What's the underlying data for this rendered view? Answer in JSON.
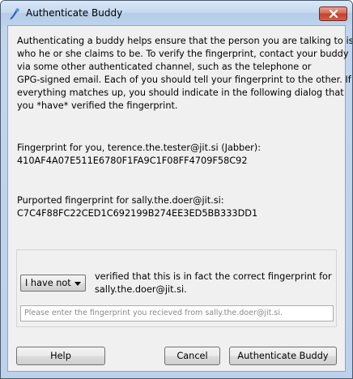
{
  "window": {
    "title": "Authenticate Buddy"
  },
  "intro": {
    "lines": [
      "Authenticating a buddy helps ensure that the person you are talking to is",
      "who he or she claims to be. To verify the fingerprint, contact your buddy",
      "via some other authenticated channel, such as the telephone or",
      "GPG-signed email. Each of you should tell your fingerprint to the other. If",
      "everything matches up, you should indicate in the following dialog that",
      "you *have* verified the fingerprint."
    ]
  },
  "own_fingerprint": {
    "label": "Fingerprint for you, terence.the.tester@jit.si (Jabber):",
    "value": "410AF4A07E511E6780F1FA9C1F08FF4709F58C92"
  },
  "buddy_fingerprint": {
    "label": "Purported fingerprint for sally.the.doer@jit.si:",
    "value": "C7C4F88FC22CED1C692199B274EE3ED5BB333DD1"
  },
  "verify": {
    "select_value": "I have not",
    "line1": "verified that this is in fact the correct fingerprint for",
    "line2": "sally.the.doer@jit.si.",
    "input_placeholder": "Please enter the fingerprint you recieved from sally.the.doer@jit.si."
  },
  "buttons": {
    "help": "Help",
    "cancel": "Cancel",
    "authenticate": "Authenticate Buddy"
  }
}
